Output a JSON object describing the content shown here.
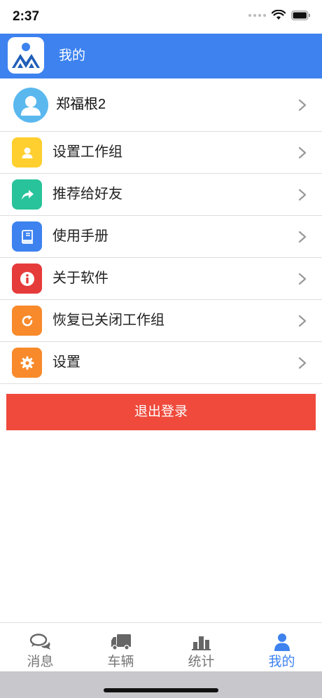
{
  "status_bar": {
    "time": "2:37"
  },
  "header": {
    "title": "我的"
  },
  "profile": {
    "name": "郑福根2"
  },
  "menu": {
    "items": [
      {
        "label": "设置工作组",
        "icon": "user-icon",
        "color": "#ffcf2f"
      },
      {
        "label": "推荐给好友",
        "icon": "share-icon",
        "color": "#28c39a"
      },
      {
        "label": "使用手册",
        "icon": "book-icon",
        "color": "#3d82ef"
      },
      {
        "label": "关于软件",
        "icon": "info-icon",
        "color": "#e63b3b"
      },
      {
        "label": "恢复已关闭工作组",
        "icon": "refresh-icon",
        "color": "#f88a2b"
      },
      {
        "label": "设置",
        "icon": "gear-icon",
        "color": "#f88a2b"
      }
    ]
  },
  "logout": {
    "label": "退出登录"
  },
  "tabbar": {
    "tabs": [
      {
        "label": "消息",
        "icon": "chat-icon"
      },
      {
        "label": "车辆",
        "icon": "truck-icon"
      },
      {
        "label": "统计",
        "icon": "bar-chart-icon"
      },
      {
        "label": "我的",
        "icon": "person-icon",
        "active": true
      }
    ]
  },
  "colors": {
    "accent": "#3d82ef",
    "logout": "#ef4a3c"
  }
}
